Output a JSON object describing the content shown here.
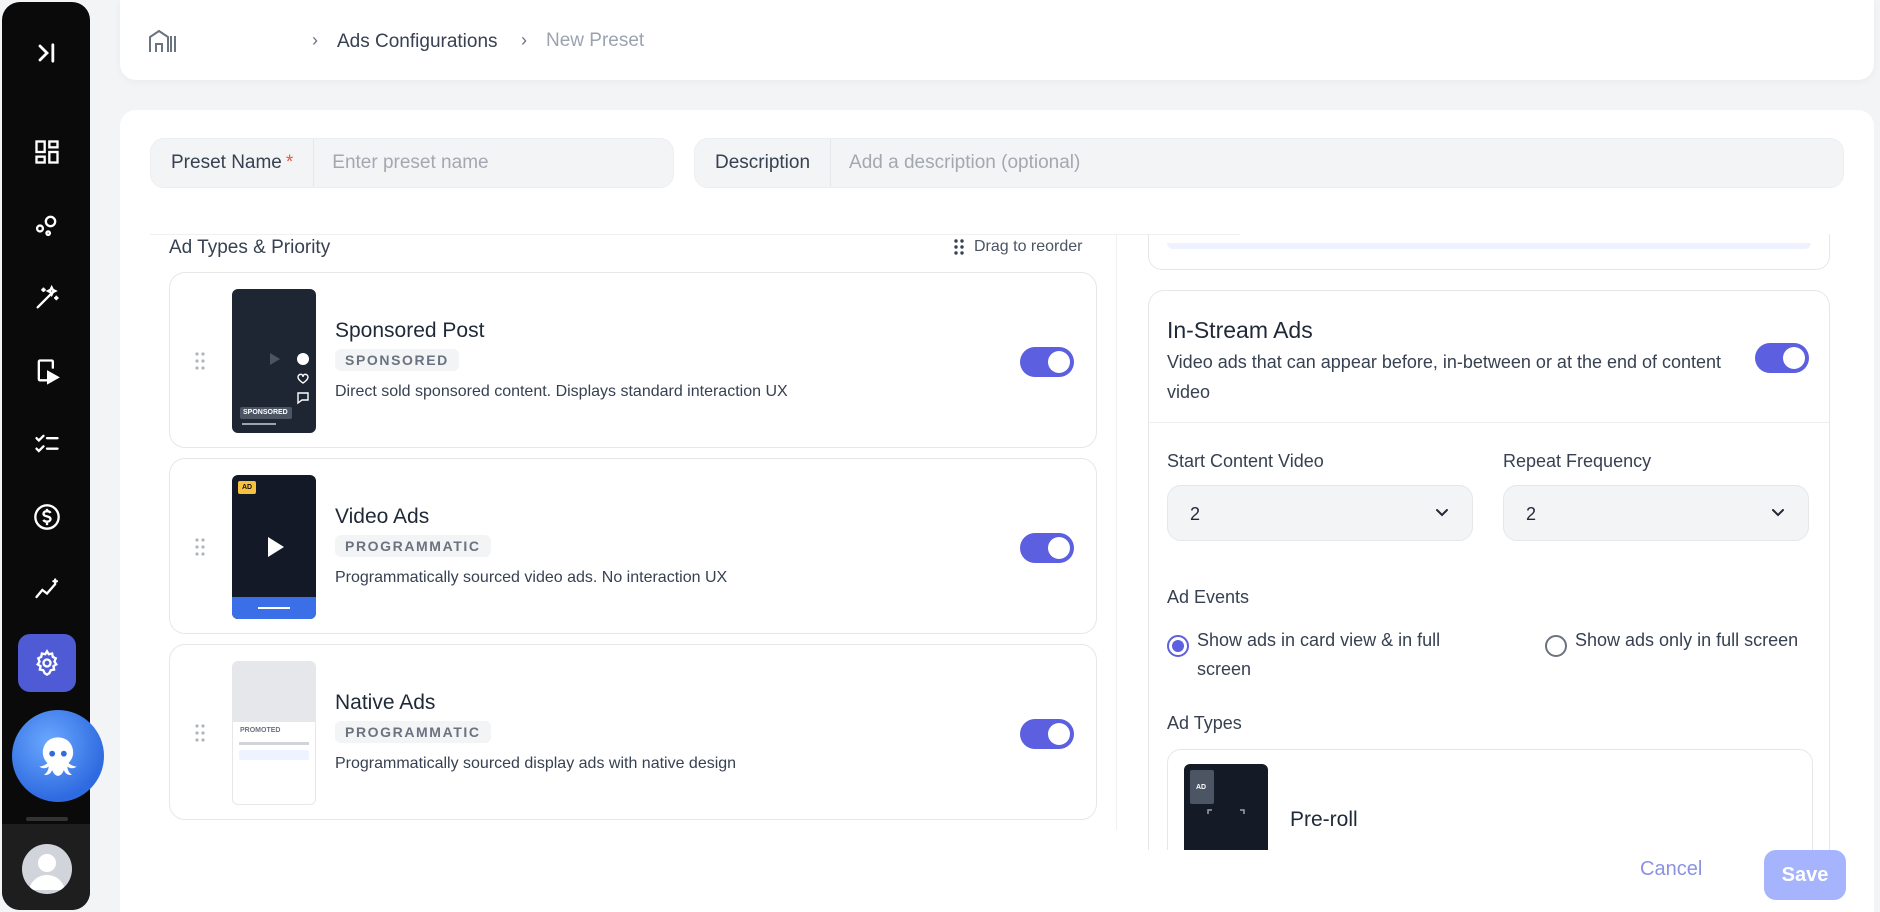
{
  "breadcrumb": {
    "home_icon": "home-icon",
    "items": [
      "Ads Configurations",
      "New Preset"
    ]
  },
  "sidebar": {
    "toggle_icon": "collapse-sidebar-icon",
    "items": [
      {
        "icon": "dashboard-icon"
      },
      {
        "icon": "integrations-icon"
      },
      {
        "icon": "magic-wand-icon"
      },
      {
        "icon": "video-player-icon"
      },
      {
        "icon": "checklist-icon"
      },
      {
        "icon": "dollar-icon"
      },
      {
        "icon": "analytics-icon"
      },
      {
        "icon": "settings-icon",
        "active": true
      }
    ],
    "assistant_icon": "octopus-icon",
    "avatar_icon": "user-avatar-icon"
  },
  "form": {
    "preset_name_label": "Preset Name",
    "preset_name_required": "*",
    "preset_name_placeholder": "Enter preset name",
    "description_label": "Description",
    "description_placeholder": "Add a description (optional)"
  },
  "ad_types": {
    "title": "Ad Types & Priority",
    "drag_hint": "Drag to reorder",
    "items": [
      {
        "title": "Sponsored Post",
        "badge": "SPONSORED",
        "description": "Direct sold sponsored content. Displays standard interaction UX",
        "enabled": true,
        "thumb_label": "SPONSORED"
      },
      {
        "title": "Video Ads",
        "badge": "PROGRAMMATIC",
        "description": "Programmatically sourced video ads. No interaction UX",
        "enabled": true,
        "thumb_label": "AD"
      },
      {
        "title": "Native Ads",
        "badge": "PROGRAMMATIC",
        "description": "Programmatically sourced display ads with native design",
        "enabled": true,
        "thumb_label": "PROMOTED"
      }
    ]
  },
  "instream": {
    "title": "In-Stream Ads",
    "description": "Video ads that can appear before, in-between or at the end of content video",
    "enabled": true,
    "start_label": "Start Content Video",
    "start_value": "2",
    "repeat_label": "Repeat Frequency",
    "repeat_value": "2",
    "events_label": "Ad Events",
    "event_options": [
      "Show ads in card view & in full screen",
      "Show ads only in full screen"
    ],
    "selected_event": 0,
    "types_label": "Ad Types",
    "sub_item_title": "Pre-roll",
    "sub_item_thumb_label": "AD"
  },
  "footer": {
    "cancel_label": "Cancel",
    "save_label": "Save"
  },
  "colors": {
    "accent": "#5b5fe0",
    "sidebar_bg": "#0a0a0a",
    "save_disabled": "#a5b4fc"
  }
}
